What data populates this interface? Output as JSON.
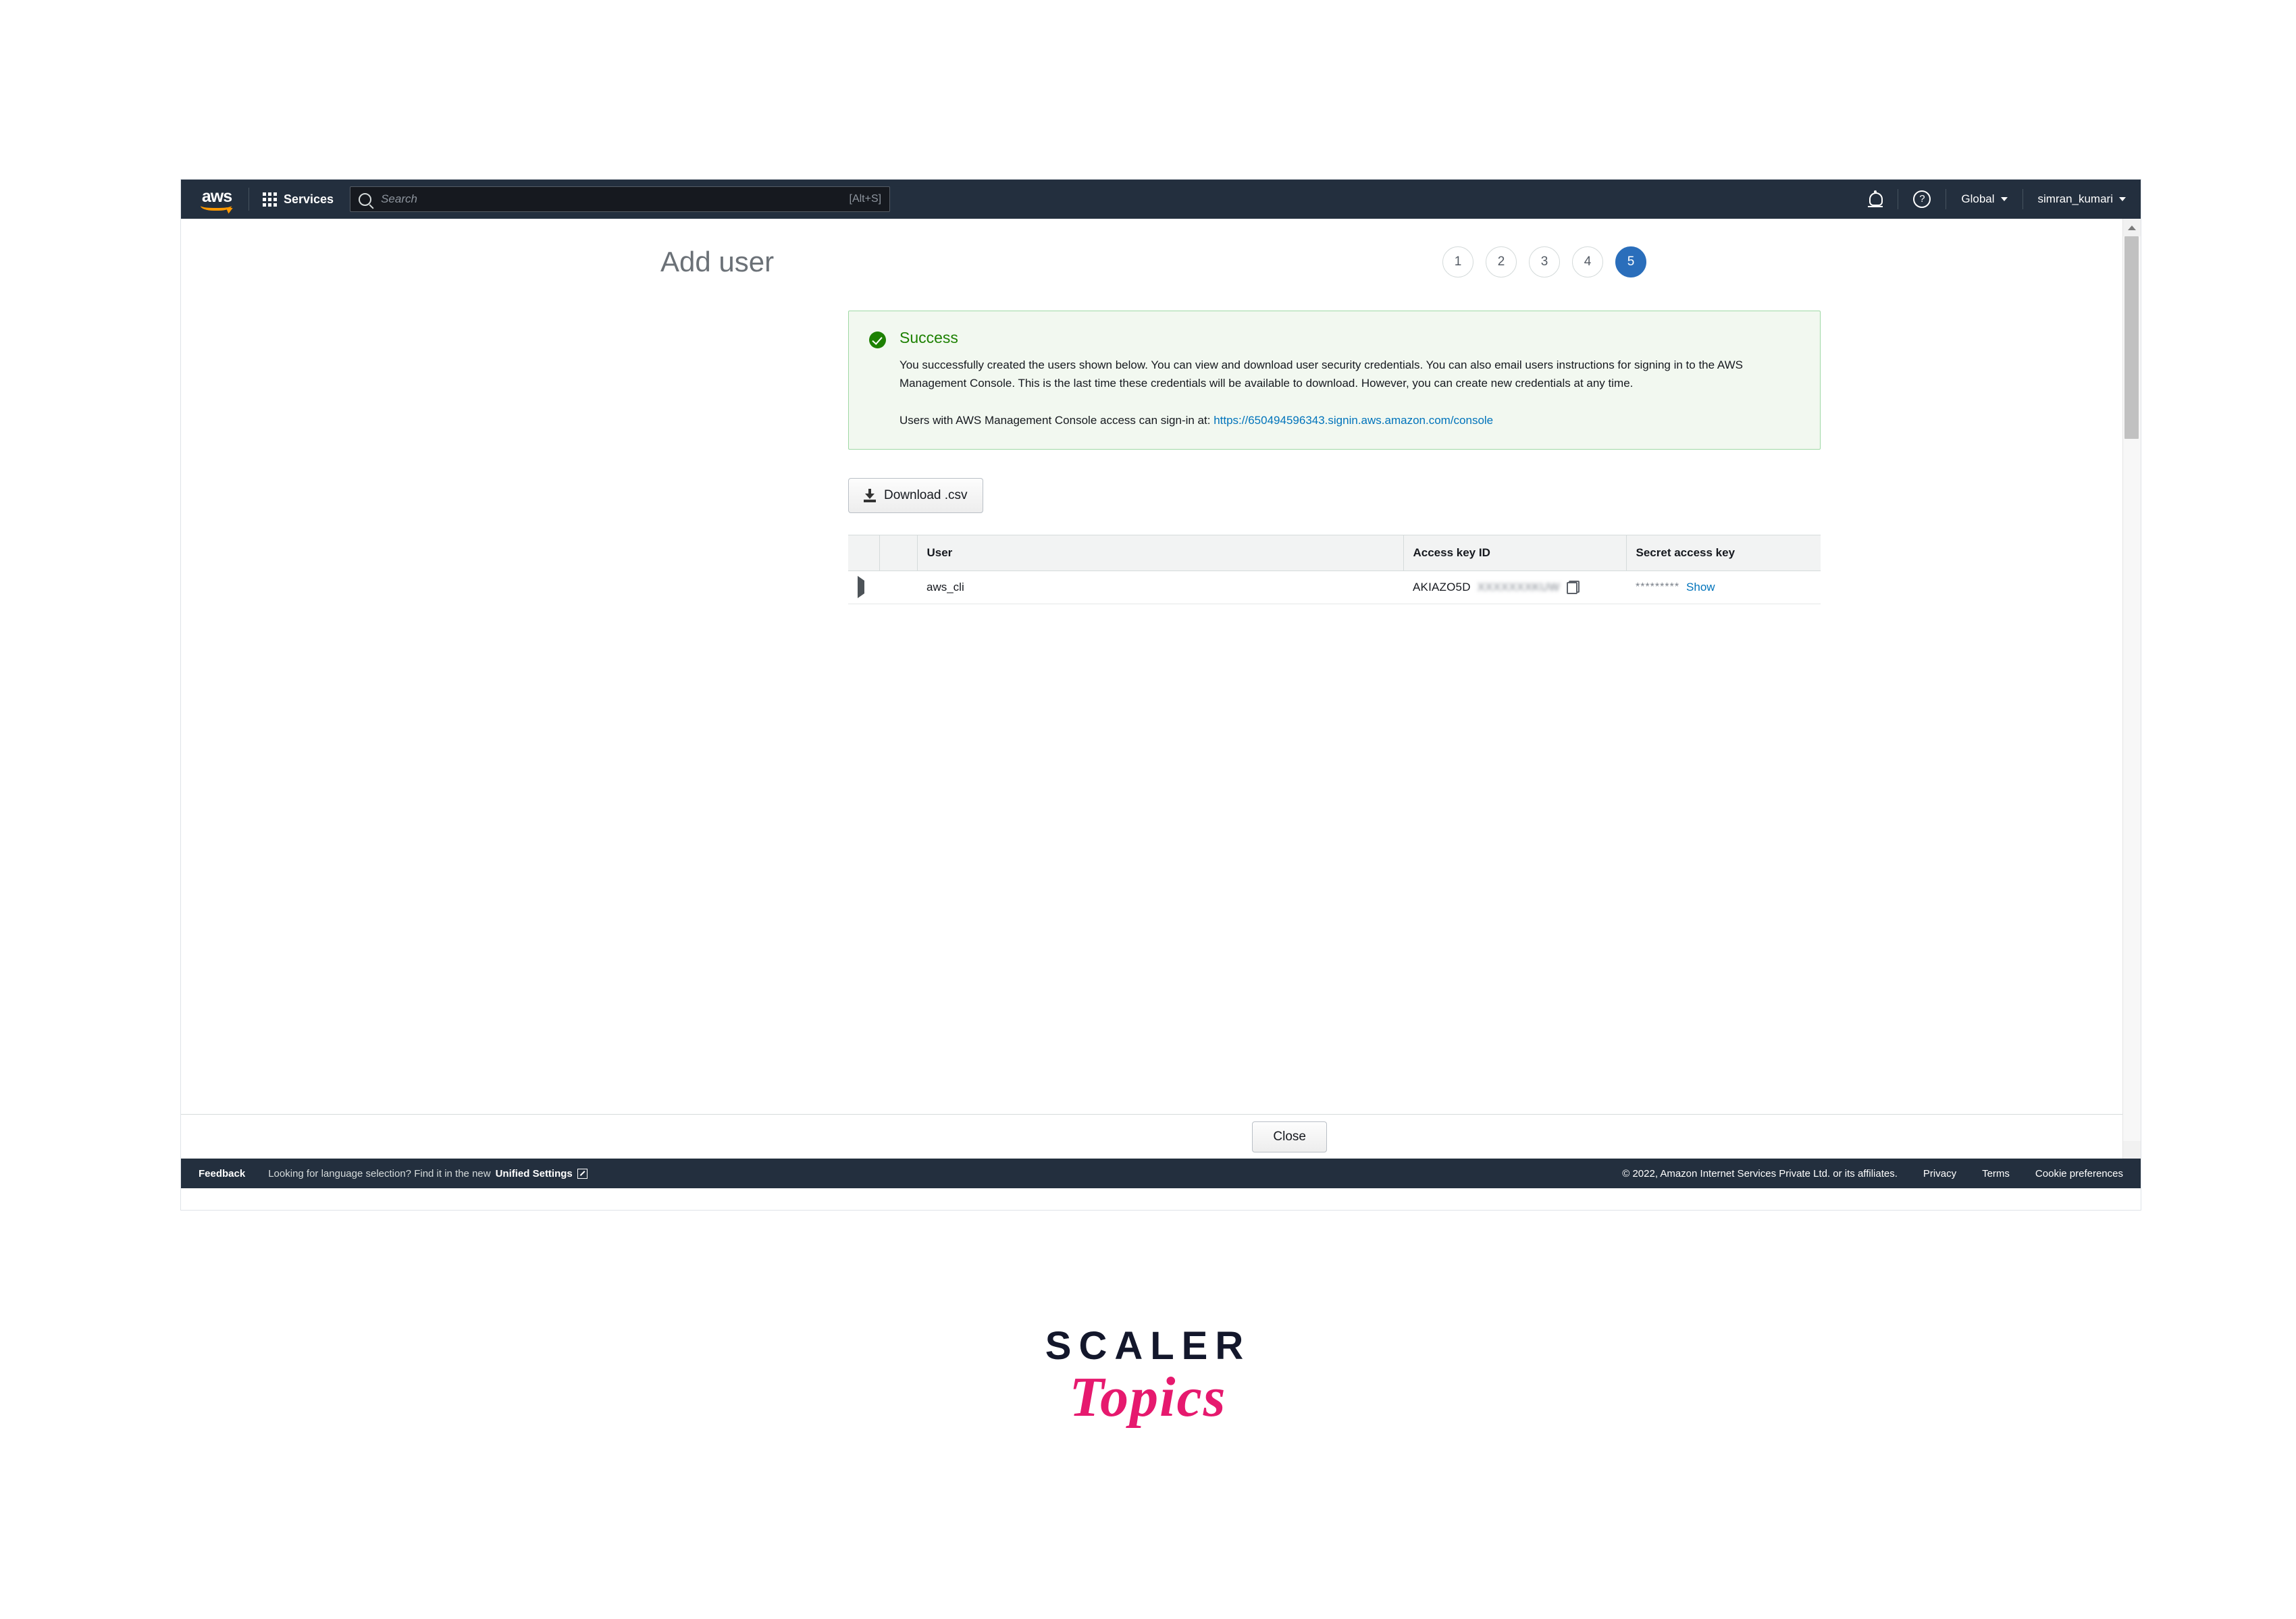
{
  "topnav": {
    "logo_text": "aws",
    "services_label": "Services",
    "search": {
      "placeholder": "Search",
      "value": "",
      "shortcut_hint": "[Alt+S]"
    },
    "region_label": "Global",
    "account_label": "simran_kumari"
  },
  "page": {
    "title": "Add user",
    "steps": [
      "1",
      "2",
      "3",
      "4",
      "5"
    ],
    "active_step": "5"
  },
  "alert": {
    "title": "Success",
    "paragraph": "You successfully created the users shown below. You can view and download user security credentials. You can also email users instructions for signing in to the AWS Management Console. This is the last time these credentials will be available to download. However, you can create new credentials at any time.",
    "signin_prefix": "Users with AWS Management Console access can sign-in at:",
    "signin_url": "https://650494596343.signin.aws.amazon.com/console",
    "border_color": "#9fd9a5",
    "background_color": "#f2f8f0",
    "accent_color": "#1d8102"
  },
  "toolbar": {
    "download_label": "Download .csv"
  },
  "table": {
    "headers": [
      "",
      "",
      "User",
      "Access key ID",
      "Secret access key"
    ],
    "rows": [
      {
        "user": "aws_cli",
        "access_key_id_visible": "AKIAZO5D",
        "access_key_id_masked": "XXXXXXXKUW",
        "secret_access_key_mask": "*********",
        "show_label": "Show",
        "status": "success"
      }
    ]
  },
  "actions": {
    "close_label": "Close"
  },
  "footer": {
    "feedback_label": "Feedback",
    "language_text": "Looking for language selection? Find it in the new",
    "language_link": "Unified Settings",
    "copyright": "© 2022, Amazon Internet Services Private Ltd. or its affiliates.",
    "links": [
      "Privacy",
      "Terms",
      "Cookie preferences"
    ]
  },
  "watermark": {
    "line1": "SCALER",
    "line2": "Topics",
    "line1_color": "#13172b",
    "line2_color": "#e6196e"
  }
}
